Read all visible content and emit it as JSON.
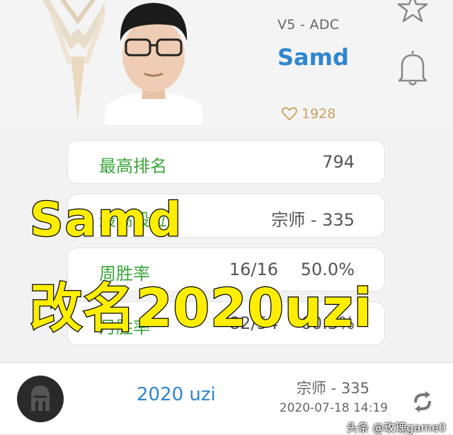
{
  "player": {
    "team_role": "V5 - ADC",
    "name": "Samd",
    "likes": "1928"
  },
  "stats": [
    {
      "label": "最高排名",
      "value": "794"
    },
    {
      "label": "最高段位",
      "value": "宗师 - 335"
    },
    {
      "label": "周胜率",
      "value_a": "16/16",
      "value_b": "50.0%"
    },
    {
      "label": "月胜率",
      "value_a": "82/54",
      "value_b": "60.3%"
    }
  ],
  "overlay": {
    "line1": "Samd",
    "line2": "改名2020uzi"
  },
  "history": {
    "name": "2020 uzi",
    "rank": "宗师 - 335",
    "time": "2020-07-18 14:19"
  },
  "watermark": "头条 @玫瑰game0",
  "colors": {
    "accent_blue": "#2f86cf",
    "stat_green": "#3aa63a",
    "like_gold": "#caa15a",
    "overlay_yellow": "#ffee00"
  },
  "icons": [
    "team-logo-icon",
    "star-icon",
    "bell-icon",
    "heart-icon",
    "helmet-icon",
    "refresh-icon"
  ]
}
